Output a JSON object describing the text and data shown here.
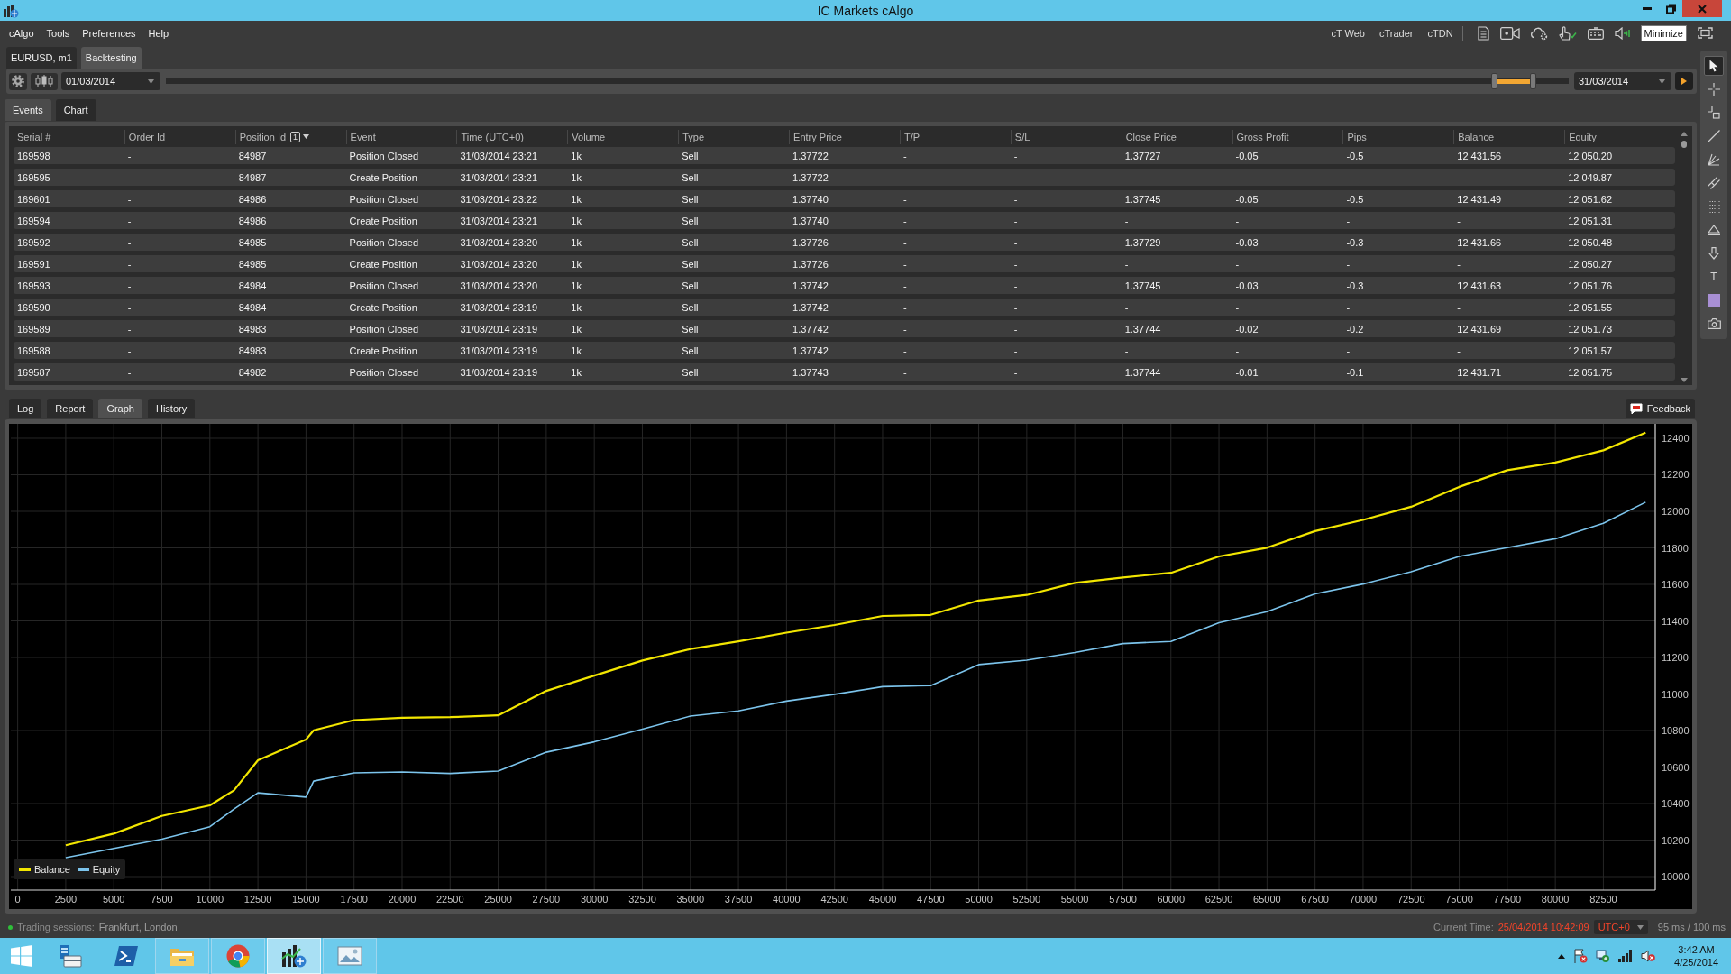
{
  "window": {
    "title": "IC Markets cAlgo"
  },
  "menu": [
    "cAlgo",
    "Tools",
    "Preferences",
    "Help"
  ],
  "platform_links": [
    "cT Web",
    "cTrader",
    "cTDN"
  ],
  "tooltip": "Minimize",
  "document_tabs": [
    {
      "label": "EURUSD, m1",
      "selected": false
    },
    {
      "label": "Backtesting",
      "selected": true
    }
  ],
  "backtest_toolbar": {
    "start_date": "01/03/2014",
    "end_date": "31/03/2014",
    "period_slider": {
      "handles": [
        {
          "level": 0.947
        },
        {
          "level": 0.975
        }
      ]
    }
  },
  "drawing_tools": [
    {
      "kind": "pointer",
      "selected": true
    },
    {
      "kind": "crosshair",
      "selected": false
    },
    {
      "kind": "crosshair-box",
      "selected": false
    },
    {
      "kind": "line",
      "selected": false
    },
    {
      "kind": "fan",
      "selected": false
    },
    {
      "kind": "parallel",
      "selected": false
    },
    {
      "kind": "grid",
      "selected": false
    },
    {
      "kind": "triangle",
      "selected": false
    },
    {
      "kind": "arrow",
      "selected": false
    },
    {
      "kind": "text",
      "label": "T",
      "selected": false
    },
    {
      "kind": "swatch",
      "selected": false
    },
    {
      "kind": "camera",
      "selected": false
    }
  ],
  "panel_tabs": [
    {
      "label": "Events",
      "selected": true
    },
    {
      "label": "Chart",
      "selected": false
    }
  ],
  "events_table": {
    "columns": [
      {
        "label": "Serial #"
      },
      {
        "label": "Order Id"
      },
      {
        "label": "Position Id",
        "sort_order": "1",
        "sort_descending": true
      },
      {
        "label": "Event"
      },
      {
        "label": "Time (UTC+0)"
      },
      {
        "label": "Volume"
      },
      {
        "label": "Type"
      },
      {
        "label": "Entry Price"
      },
      {
        "label": "T/P"
      },
      {
        "label": "S/L"
      },
      {
        "label": "Close Price"
      },
      {
        "label": "Gross Profit"
      },
      {
        "label": "Pips"
      },
      {
        "label": "Balance"
      },
      {
        "label": "Equity"
      }
    ],
    "rows": [
      [
        "169598",
        "-",
        "84987",
        "Position Closed",
        "31/03/2014 23:21",
        "1k",
        "Sell",
        "1.37722",
        "-",
        "-",
        "1.37727",
        "-0.05",
        "-0.5",
        "12 431.56",
        "12 050.20"
      ],
      [
        "169595",
        "-",
        "84987",
        "Create Position",
        "31/03/2014 23:21",
        "1k",
        "Sell",
        "1.37722",
        "-",
        "-",
        "-",
        "-",
        "-",
        "-",
        "12 049.87"
      ],
      [
        "169601",
        "-",
        "84986",
        "Position Closed",
        "31/03/2014 23:22",
        "1k",
        "Sell",
        "1.37740",
        "-",
        "-",
        "1.37745",
        "-0.05",
        "-0.5",
        "12 431.49",
        "12 051.62"
      ],
      [
        "169594",
        "-",
        "84986",
        "Create Position",
        "31/03/2014 23:21",
        "1k",
        "Sell",
        "1.37740",
        "-",
        "-",
        "-",
        "-",
        "-",
        "-",
        "12 051.31"
      ],
      [
        "169592",
        "-",
        "84985",
        "Position Closed",
        "31/03/2014 23:20",
        "1k",
        "Sell",
        "1.37726",
        "-",
        "-",
        "1.37729",
        "-0.03",
        "-0.3",
        "12 431.66",
        "12 050.48"
      ],
      [
        "169591",
        "-",
        "84985",
        "Create Position",
        "31/03/2014 23:20",
        "1k",
        "Sell",
        "1.37726",
        "-",
        "-",
        "-",
        "-",
        "-",
        "-",
        "12 050.27"
      ],
      [
        "169593",
        "-",
        "84984",
        "Position Closed",
        "31/03/2014 23:20",
        "1k",
        "Sell",
        "1.37742",
        "-",
        "-",
        "1.37745",
        "-0.03",
        "-0.3",
        "12 431.63",
        "12 051.76"
      ],
      [
        "169590",
        "-",
        "84984",
        "Create Position",
        "31/03/2014 23:19",
        "1k",
        "Sell",
        "1.37742",
        "-",
        "-",
        "-",
        "-",
        "-",
        "-",
        "12 051.55"
      ],
      [
        "169589",
        "-",
        "84983",
        "Position Closed",
        "31/03/2014 23:19",
        "1k",
        "Sell",
        "1.37742",
        "-",
        "-",
        "1.37744",
        "-0.02",
        "-0.2",
        "12 431.69",
        "12 051.73"
      ],
      [
        "169588",
        "-",
        "84983",
        "Create Position",
        "31/03/2014 23:19",
        "1k",
        "Sell",
        "1.37742",
        "-",
        "-",
        "-",
        "-",
        "-",
        "-",
        "12 051.57"
      ],
      [
        "169587",
        "-",
        "84982",
        "Position Closed",
        "31/03/2014 23:19",
        "1k",
        "Sell",
        "1.37743",
        "-",
        "-",
        "1.37744",
        "-0.01",
        "-0.1",
        "12 431.71",
        "12 051.75"
      ]
    ]
  },
  "result_tabs": [
    {
      "label": "Log",
      "selected": false
    },
    {
      "label": "Report",
      "selected": false
    },
    {
      "label": "Graph",
      "selected": true
    },
    {
      "label": "History",
      "selected": false
    }
  ],
  "feedback_button": "Feedback",
  "graph": {
    "chart_data": {
      "type": "line",
      "x": [
        2500,
        5000,
        7500,
        10000,
        11250,
        12500,
        15000,
        15400,
        17500,
        20000,
        22500,
        25000,
        27500,
        30000,
        32500,
        35000,
        37500,
        40000,
        42500,
        45000,
        47500,
        50000,
        52500,
        55000,
        57500,
        60000,
        62500,
        65000,
        67500,
        70000,
        72500,
        75000,
        77500,
        80000,
        82500,
        84700
      ],
      "series": [
        {
          "name": "Balance",
          "color": "#f2e600",
          "values": [
            10172,
            10235,
            10332,
            10390,
            10472,
            10637,
            10750,
            10801,
            10857,
            10870,
            10873,
            10883,
            11017,
            11101,
            11183,
            11246,
            11288,
            11336,
            11378,
            11427,
            11433,
            11512,
            11542,
            11608,
            11638,
            11663,
            11753,
            11801,
            11892,
            11953,
            12025,
            12134,
            12225,
            12267,
            12334,
            12431
          ]
        },
        {
          "name": "Equity",
          "color": "#7cc4ec",
          "values": [
            10104,
            10154,
            10205,
            10273,
            10370,
            10459,
            10435,
            10523,
            10568,
            10573,
            10565,
            10578,
            10681,
            10738,
            10807,
            10879,
            10907,
            10961,
            10998,
            11040,
            11046,
            11161,
            11185,
            11227,
            11276,
            11288,
            11390,
            11451,
            11548,
            11602,
            11669,
            11753,
            11801,
            11850,
            11935,
            12050
          ]
        }
      ],
      "xlim": [
        -357,
        85200
      ],
      "ylim": [
        9926,
        12479
      ],
      "xticks": [
        0,
        2500,
        5000,
        7500,
        10000,
        12500,
        15000,
        17500,
        20000,
        22500,
        25000,
        27500,
        30000,
        32500,
        35000,
        37500,
        40000,
        42500,
        45000,
        47500,
        50000,
        52500,
        55000,
        57500,
        60000,
        62500,
        65000,
        67500,
        70000,
        72500,
        75000,
        77500,
        80000,
        82500
      ],
      "yticks": [
        10000,
        10200,
        10400,
        10600,
        10800,
        11000,
        11200,
        11400,
        11600,
        11800,
        12000,
        12200,
        12400
      ],
      "grid": true,
      "legend": true
    }
  },
  "status_bar": {
    "sessions_label": "Trading sessions:",
    "sessions": "Frankfurt, London",
    "time_label": "Current Time:",
    "time": "25/04/2014 10:42:09",
    "timezone": "UTC+0",
    "latency": "95 ms / 100 ms"
  },
  "taskbar": {
    "apps": [
      {
        "kind": "server",
        "running": false,
        "selected": false
      },
      {
        "kind": "terminal",
        "running": false,
        "selected": false
      },
      {
        "kind": "folder",
        "running": true,
        "selected": false
      },
      {
        "kind": "browser",
        "running": true,
        "selected": false
      },
      {
        "kind": "chart",
        "running": true,
        "selected": true
      },
      {
        "kind": "gallery",
        "running": true,
        "selected": false
      }
    ],
    "clock": {
      "time": "3:42 AM",
      "date": "4/25/2014"
    }
  }
}
